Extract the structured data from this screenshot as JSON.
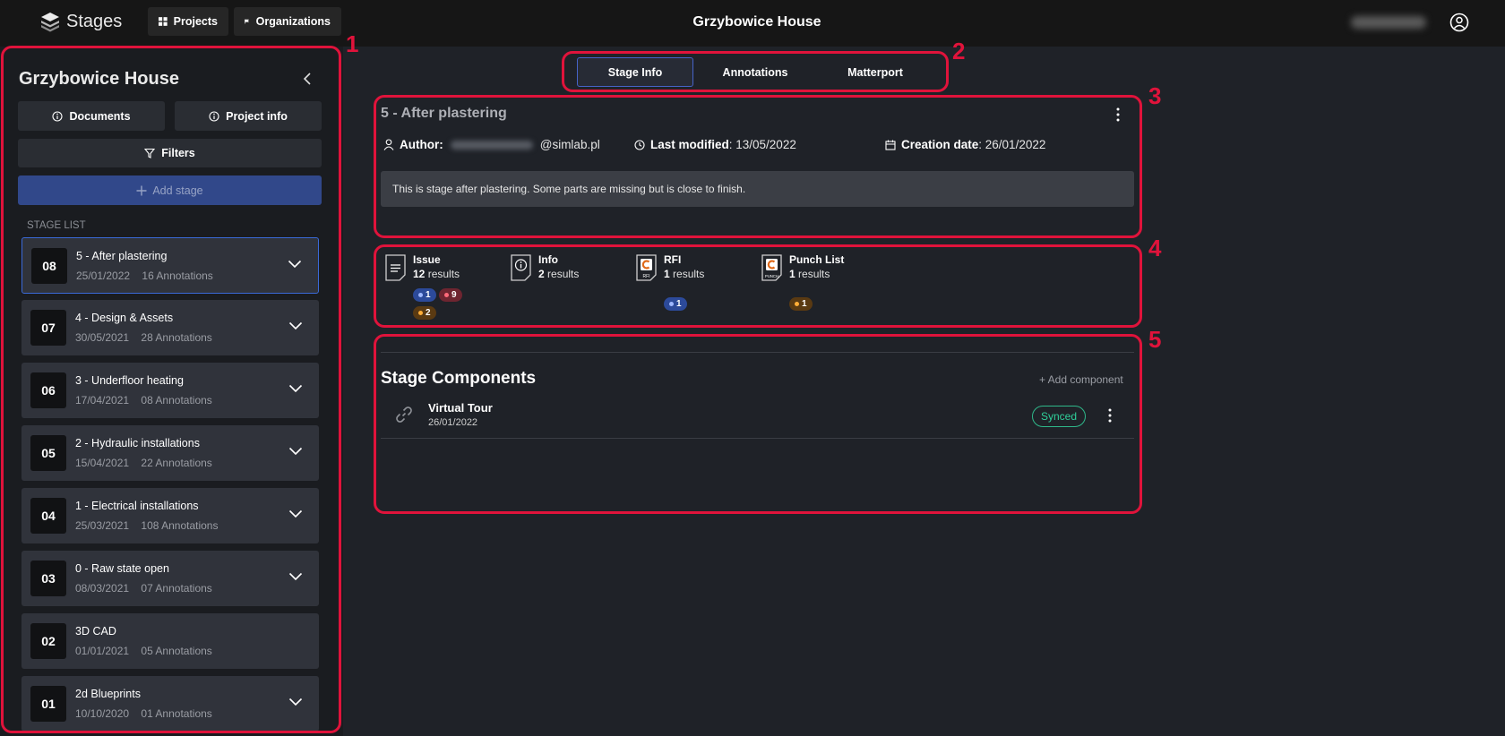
{
  "topbar": {
    "logo_text": "Stages",
    "projects_label": "Projects",
    "organizations_label": "Organizations",
    "title": "Grzybowice House"
  },
  "sidebar": {
    "title": "Grzybowice House",
    "documents_label": "Documents",
    "project_info_label": "Project info",
    "filters_label": "Filters",
    "add_stage_label": "Add stage",
    "stage_list_label": "STAGE LIST",
    "stages": [
      {
        "num": "08",
        "name": "5 - After plastering",
        "meta": "25/01/2022    16 Annotations"
      },
      {
        "num": "07",
        "name": "4 - Design & Assets",
        "meta": "30/05/2021    28 Annotations"
      },
      {
        "num": "06",
        "name": "3 - Underfloor heating",
        "meta": "17/04/2021    08 Annotations"
      },
      {
        "num": "05",
        "name": "2 - Hydraulic installations",
        "meta": "15/04/2021    22 Annotations"
      },
      {
        "num": "04",
        "name": "1 - Electrical installations",
        "meta": "25/03/2021    108 Annotations"
      },
      {
        "num": "03",
        "name": "0 - Raw state open",
        "meta": "08/03/2021    07 Annotations"
      },
      {
        "num": "02",
        "name": "3D CAD",
        "meta": "01/01/2021    05 Annotations"
      },
      {
        "num": "01",
        "name": "2d Blueprints",
        "meta": "10/10/2020    01 Annotations"
      }
    ]
  },
  "tabs": [
    "Stage Info",
    "Annotations",
    "Matterport"
  ],
  "stage_info": {
    "title": "5 - After plastering",
    "author_label": "Author:",
    "author_domain": "@simlab.pl",
    "last_modified_label": "Last modified",
    "last_modified_value": ": 13/05/2022",
    "creation_label": "Creation date",
    "creation_value": ": 26/01/2022",
    "description": "This is stage after plastering. Some parts are missing but is close to finish."
  },
  "summary": [
    {
      "name": "Issue",
      "count": "12",
      "suffix": " results",
      "pills": [
        "1",
        "9",
        "2"
      ]
    },
    {
      "name": "Info",
      "count": "2",
      "suffix": " results",
      "pills": []
    },
    {
      "name": "RFI",
      "count": "1",
      "suffix": " results",
      "pills": [
        "1"
      ],
      "icon_caption": "RFI"
    },
    {
      "name": "Punch List",
      "count": "1",
      "suffix": " results",
      "pills": [
        "1"
      ],
      "icon_caption": "PUNCH"
    }
  ],
  "components": {
    "title": "Stage Components",
    "add_label": "+ Add component",
    "items": [
      {
        "name": "Virtual Tour",
        "date": "26/01/2022",
        "status": "Synced"
      }
    ]
  },
  "annotation_numbers": [
    "1",
    "2",
    "3",
    "4",
    "5"
  ],
  "colors": {
    "annotation_red": "#e0133b",
    "accent_blue": "#3a6ad8",
    "synced_green": "#2fb88a",
    "pill_blue": "#2c4a9a",
    "pill_red": "#6e2530",
    "pill_orange": "#5a3a12"
  }
}
